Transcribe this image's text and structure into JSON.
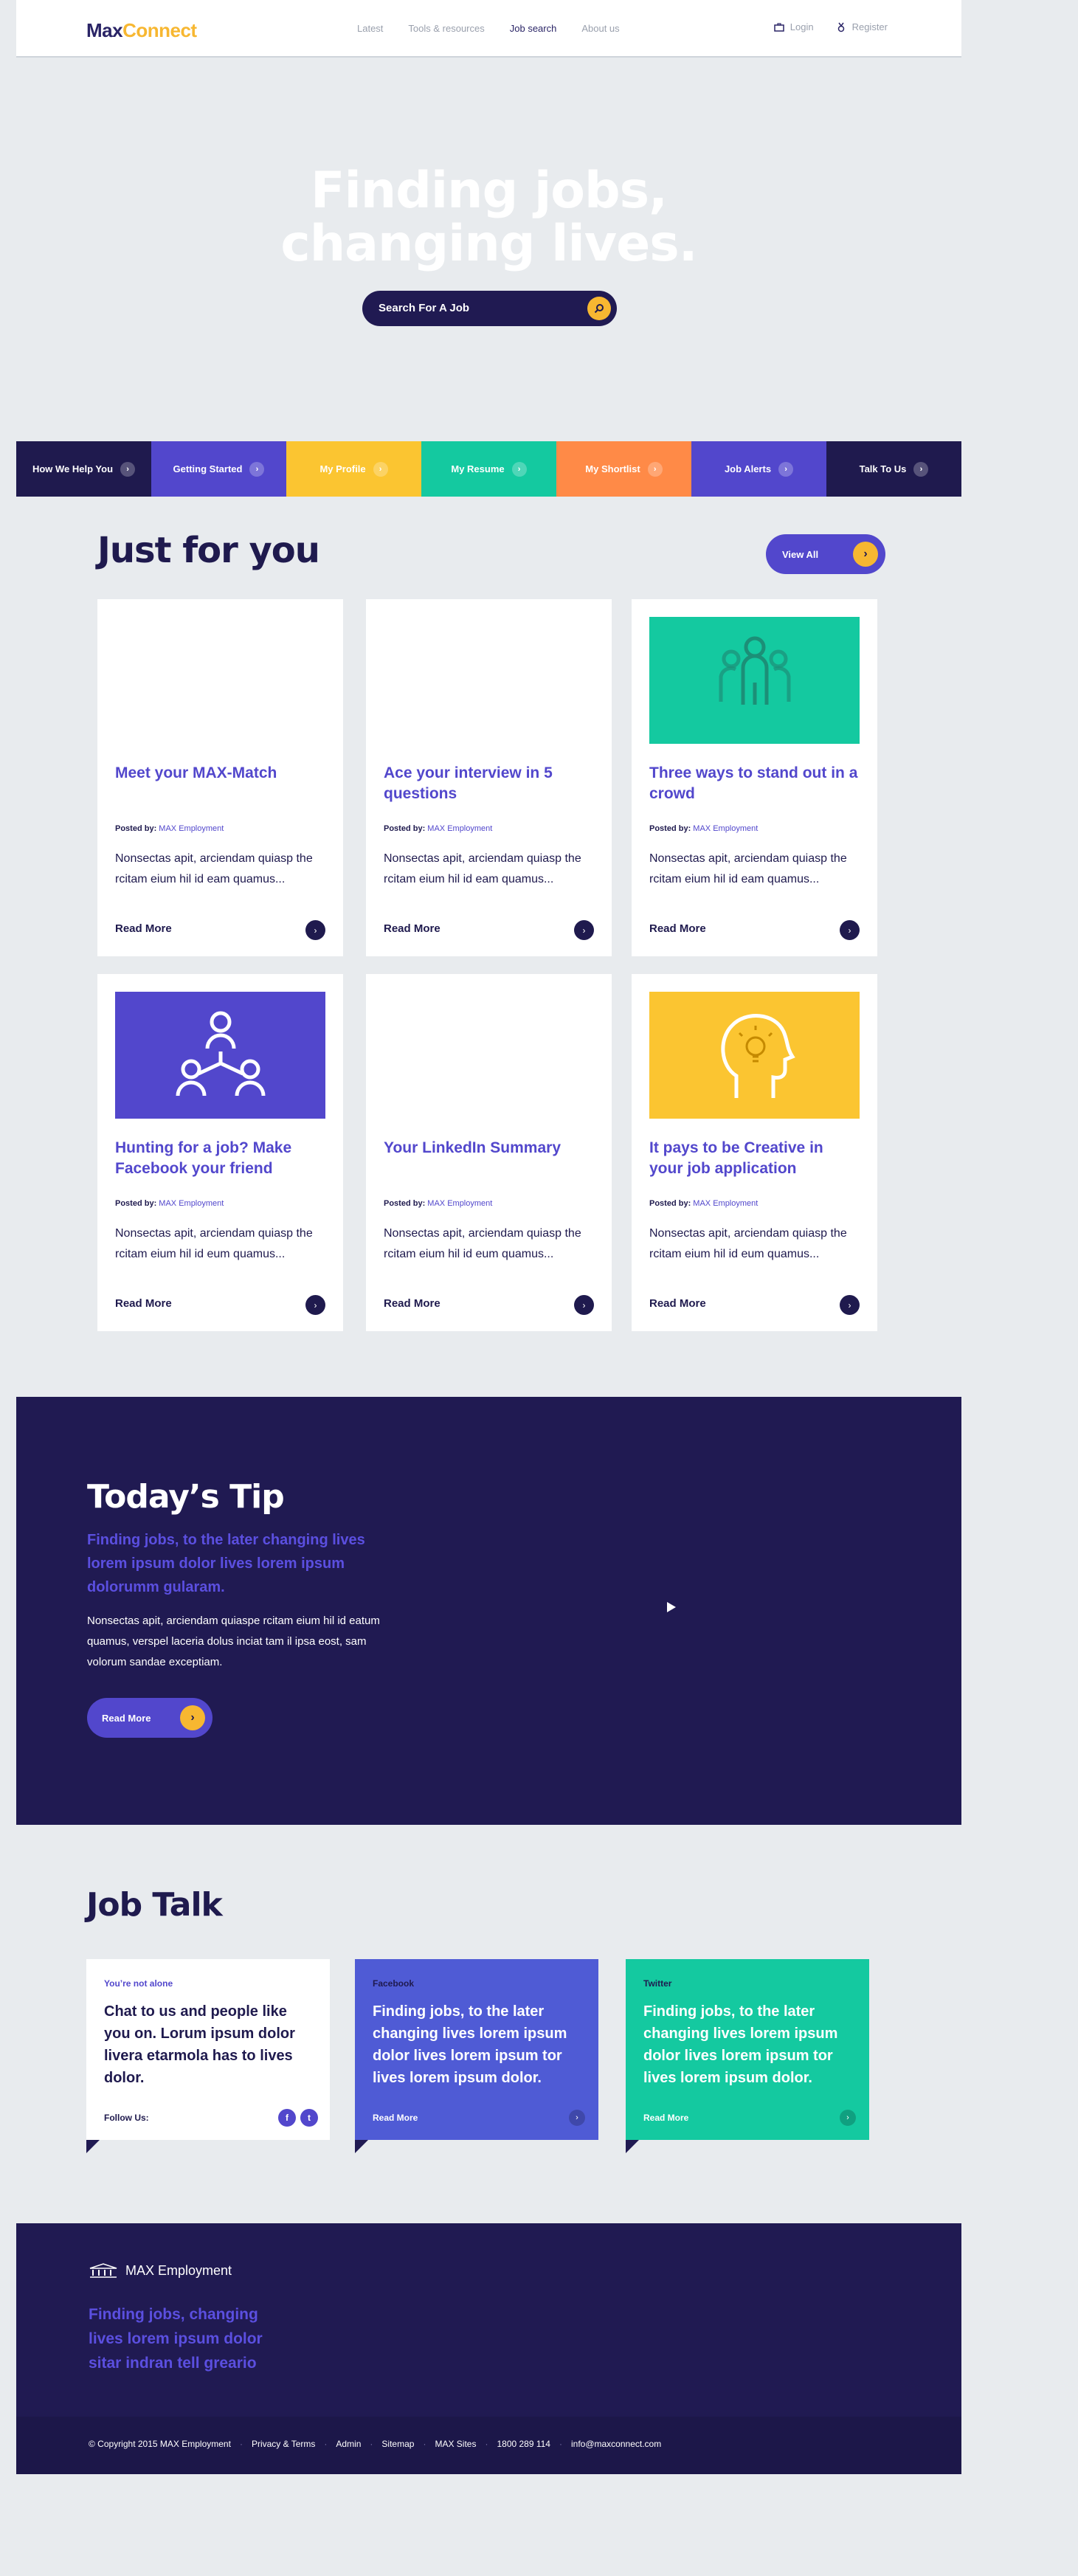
{
  "header": {
    "logo_part1": "Max",
    "logo_part2": "Connect",
    "nav": [
      "Latest",
      "Tools & resources",
      "Job search",
      "About us"
    ],
    "active_nav": "Job search",
    "login": "Login",
    "register": "Register"
  },
  "hero": {
    "title_line1": "Finding jobs,",
    "title_line2": "changing lives.",
    "search_label": "Search For A Job"
  },
  "tabs": [
    {
      "label": "How We Help You",
      "color": "#1f1a4e"
    },
    {
      "label": "Getting Started",
      "color": "#5247cc"
    },
    {
      "label": "My Profile",
      "color": "#fbc531"
    },
    {
      "label": "My Resume",
      "color": "#14c9a0"
    },
    {
      "label": "My Shortlist",
      "color": "#ff8a47"
    },
    {
      "label": "Job Alerts",
      "color": "#5247cc"
    },
    {
      "label": "Talk To Us",
      "color": "#1f1a4e"
    }
  ],
  "just_for_you": {
    "title": "Just for you",
    "view_all": "View All",
    "posted_by_label": "Posted by:",
    "cards": [
      {
        "title": "Meet your MAX-Match",
        "author": "MAX Employment",
        "excerpt": "Nonsectas apit, arciendam quiasp the rcitam eium hil id eam quamus...",
        "read_more": "Read More",
        "media": "none",
        "media_color": ""
      },
      {
        "title": "Ace your interview in 5 questions",
        "author": "MAX Employment",
        "excerpt": "Nonsectas apit, arciendam quiasp the rcitam eium hil id eam quamus...",
        "read_more": "Read More",
        "media": "none",
        "media_color": ""
      },
      {
        "title": "Three ways to stand out in a crowd",
        "author": "MAX Employment",
        "excerpt": "Nonsectas apit, arciendam quiasp the rcitam eium hil id eam quamus...",
        "read_more": "Read More",
        "media": "people-group-icon",
        "media_color": "#14c9a0"
      },
      {
        "title": "Hunting for a job? Make Facebook your friend",
        "author": "MAX Employment",
        "excerpt": "Nonsectas apit, arciendam quiasp the rcitam eium hil id eum quamus...",
        "read_more": "Read More",
        "media": "network-icon",
        "media_color": "#5247cc"
      },
      {
        "title": "Your LinkedIn Summary",
        "author": "MAX Employment",
        "excerpt": "Nonsectas apit, arciendam quiasp the rcitam eium hil id eum quamus...",
        "read_more": "Read More",
        "media": "none",
        "media_color": ""
      },
      {
        "title": "It pays to be Creative in your job application",
        "author": "MAX Employment",
        "excerpt": "Nonsectas apit, arciendam quiasp the rcitam eium hil id eum quamus...",
        "read_more": "Read More",
        "media": "head-lightbulb-icon",
        "media_color": "#fbc531"
      }
    ]
  },
  "tip": {
    "title": "Today’s Tip",
    "lead": "Finding jobs, to the later changing lives lorem ipsum dolor lives lorem ipsum dolorumm gularam.",
    "body": "Nonsectas apit, arciendam quiaspe rcitam eium hil id eatum quamus, verspel laceria dolus inciat tam il ipsa eost, sam volorum sandae exceptiam.",
    "read_more": "Read More"
  },
  "job_talk": {
    "title": "Job Talk",
    "cards": [
      {
        "label": "You’re not alone",
        "text": "Chat to us and people like you on. Lorum ipsum dolor livera etarmola has to lives dolor.",
        "footer": "Follow Us:",
        "bg": "#ffffff"
      },
      {
        "label": "Facebook",
        "text": "Finding jobs, to the later changing lives lorem ipsum dolor lives lorem ipsum tor lives lorem ipsum dolor.",
        "footer": "Read More",
        "bg": "#4f5bd5"
      },
      {
        "label": "Twitter",
        "text": "Finding jobs, to the later changing lives lorem ipsum dolor lives lorem ipsum tor lives lorem ipsum dolor.",
        "footer": "Read More",
        "bg": "#14c9a0"
      }
    ]
  },
  "footer": {
    "brand": "MAX Employment",
    "tagline": "Finding jobs, changing lives lorem ipsum dolor sitar indran tell greario",
    "links": [
      "© Copyright 2015 MAX Employment",
      "Privacy & Terms",
      "Admin",
      "Sitemap",
      "MAX Sites",
      "1800 289 114",
      "info@maxconnect.com"
    ]
  }
}
